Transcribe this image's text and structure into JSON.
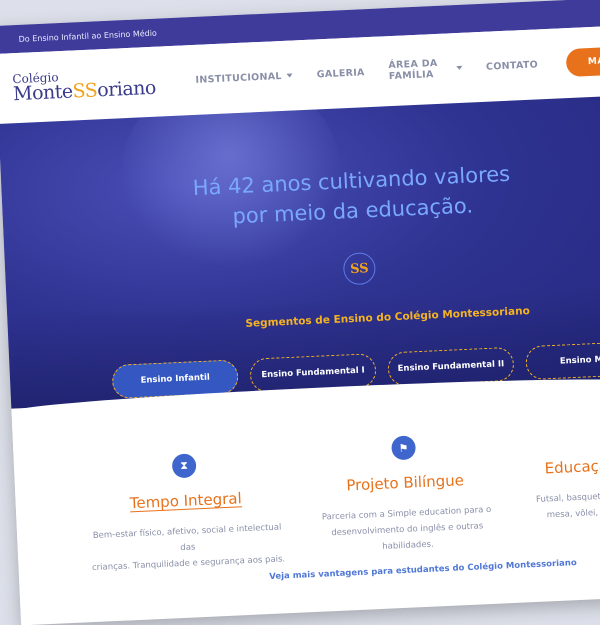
{
  "topbar": {
    "tagline": "Do Ensino Infantil ao Ensino Médio"
  },
  "logo": {
    "line1": "Colégio",
    "line2a": "Monte",
    "line2b": "SS",
    "line2c": "oriano"
  },
  "nav": {
    "items": [
      {
        "label": "INSTITUCIONAL",
        "dropdown": true
      },
      {
        "label": "GALERIA",
        "dropdown": false
      },
      {
        "label": "ÁREA DA FAMÍLIA",
        "dropdown": true
      },
      {
        "label": "CONTATO",
        "dropdown": false
      }
    ],
    "cta_label": "MATR"
  },
  "hero": {
    "headline_line1": "Há 42 anos cultivando valores",
    "headline_line2": "por meio da educação.",
    "badge_text": "SS",
    "segments_title": "Segmentos de Ensino do Colégio Montessoriano",
    "segments": [
      "Ensino Infantil",
      "Ensino Fundamental I",
      "Ensino Fundamental II",
      "Ensino Médi"
    ]
  },
  "features": [
    {
      "icon": "hourglass-icon",
      "title": "Tempo Integral",
      "desc_line1": "Bem-estar físico, afetivo, social e intelectual das",
      "desc_line2": "crianças. Tranquilidade e segurança aos pais."
    },
    {
      "icon": "flag-icon",
      "title": "Projeto Bilíngue",
      "desc_line1": "Parceria com a Simple education para o",
      "desc_line2": "desenvolvimento do inglês e outras habilidades."
    },
    {
      "icon": "sports-icon",
      "title": "Educação",
      "desc_line1": "Futsal, basquete, bac",
      "desc_line2": "mesa, vôlei, xadre"
    }
  ],
  "more_link": "Veja mais vantagens para estudantes do Colégio Montessoriano",
  "colors": {
    "primary": "#3f3b9a",
    "accent": "#e8721c",
    "gold": "#f5b321",
    "link": "#5178d6"
  }
}
